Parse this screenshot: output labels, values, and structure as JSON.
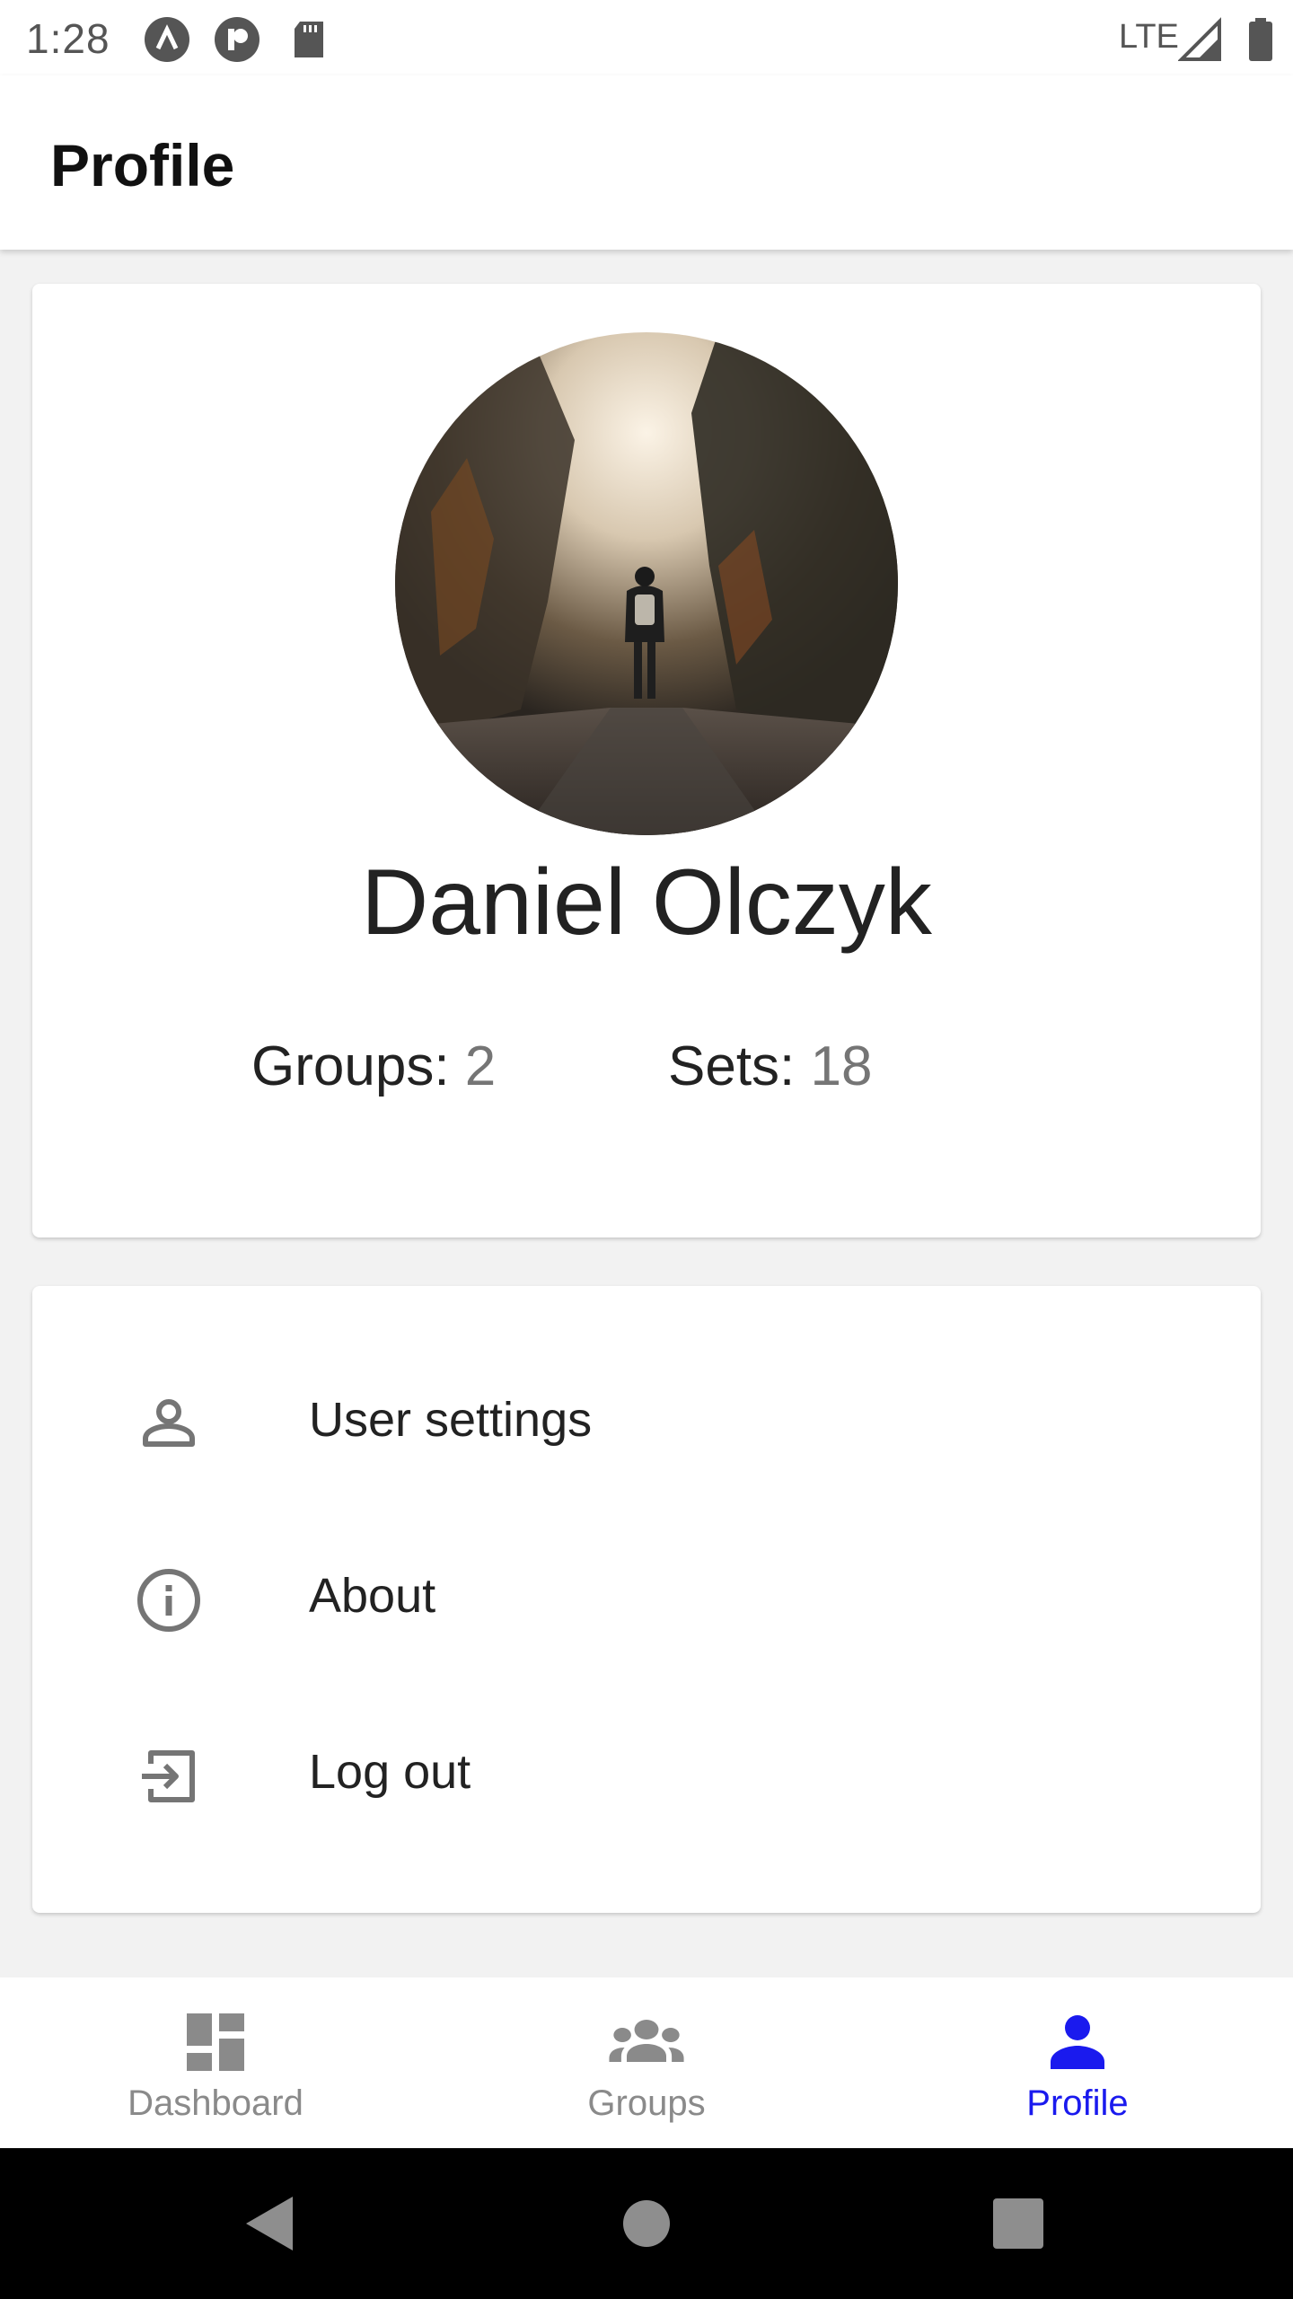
{
  "status_bar": {
    "time": "1:28",
    "network": "LTE",
    "icons": [
      "app-a-icon",
      "app-p-icon",
      "sd-card-icon",
      "signal-icon",
      "battery-icon"
    ]
  },
  "app_bar": {
    "title": "Profile"
  },
  "profile": {
    "name": "Daniel Olczyk",
    "avatar": "forest-road-hiker-photo",
    "stats": {
      "groups_label": "Groups: ",
      "groups_value": "2",
      "sets_label": "Sets: ",
      "sets_value": "18"
    }
  },
  "menu": {
    "items": [
      {
        "label": "User settings",
        "icon": "person-outline-icon"
      },
      {
        "label": "About",
        "icon": "info-outline-icon"
      },
      {
        "label": "Log out",
        "icon": "logout-icon"
      }
    ]
  },
  "bottom_nav": {
    "items": [
      {
        "label": "Dashboard",
        "icon": "dashboard-icon",
        "active": false
      },
      {
        "label": "Groups",
        "icon": "groups-icon",
        "active": false
      },
      {
        "label": "Profile",
        "icon": "person-icon",
        "active": true
      }
    ],
    "active_color": "#1a1aee",
    "inactive_color": "#8a8a8a"
  }
}
